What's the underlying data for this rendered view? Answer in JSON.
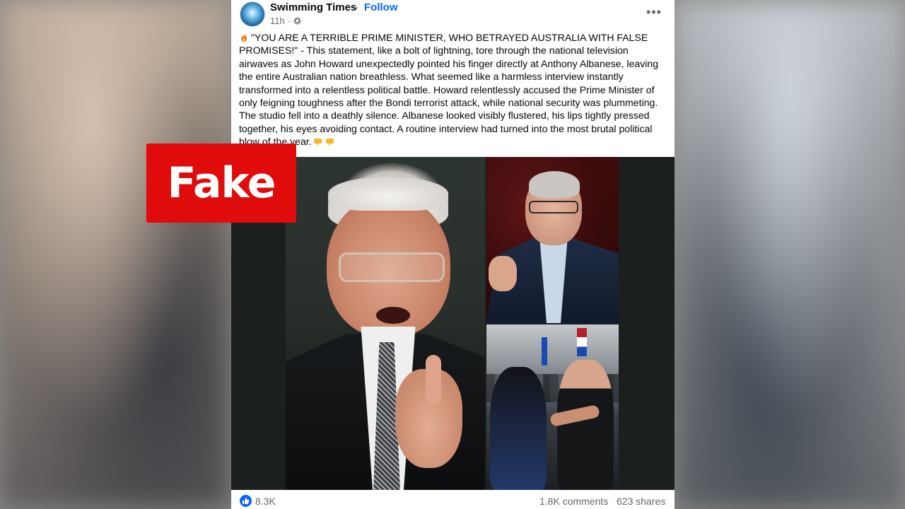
{
  "post": {
    "page_name": "Swimming Times",
    "separator": "·",
    "follow_label": "Follow",
    "time": "11h",
    "time_separator": "·",
    "avatar_text": "SWIMMING TIMES",
    "more_label": "•••",
    "body": "\"YOU ARE A TERRIBLE PRIME MINISTER, WHO BETRAYED AUSTRALIA WITH FALSE PROMISES!\" - This statement, like a bolt of lightning, tore through the national television airwaves as John Howard unexpectedly pointed his finger directly at Anthony Albanese, leaving the entire Australian nation breathless. What seemed like a harmless interview instantly transformed into a relentless political battle. Howard relentlessly accused the Prime Minister of only feigning toughness after the Bondi terrorist attack, while national security was plummeting. The studio fell into a deathly silence. Albanese looked visibly flustered, his lips tightly pressed together, his eyes avoiding contact. A routine interview had turned into the most brutal political blow of the year.",
    "leading_icon": "fire-emoji-icon",
    "trailing_icons": [
      "pointing-down-emoji-icon",
      "pointing-down-emoji-icon"
    ]
  },
  "overlay": {
    "fake_label": "Fake",
    "color": "#e00b0b"
  },
  "images": [
    {
      "name": "john-howard-pointing-photo"
    },
    {
      "name": "anthony-albanese-photo"
    },
    {
      "name": "protest-clash-photo"
    }
  ],
  "footer": {
    "reactions_count": "8.3K",
    "comments": "1.8K comments",
    "shares": "623 shares"
  },
  "colors": {
    "accent": "#0866ff",
    "text": "#050505",
    "muted": "#65676b"
  }
}
